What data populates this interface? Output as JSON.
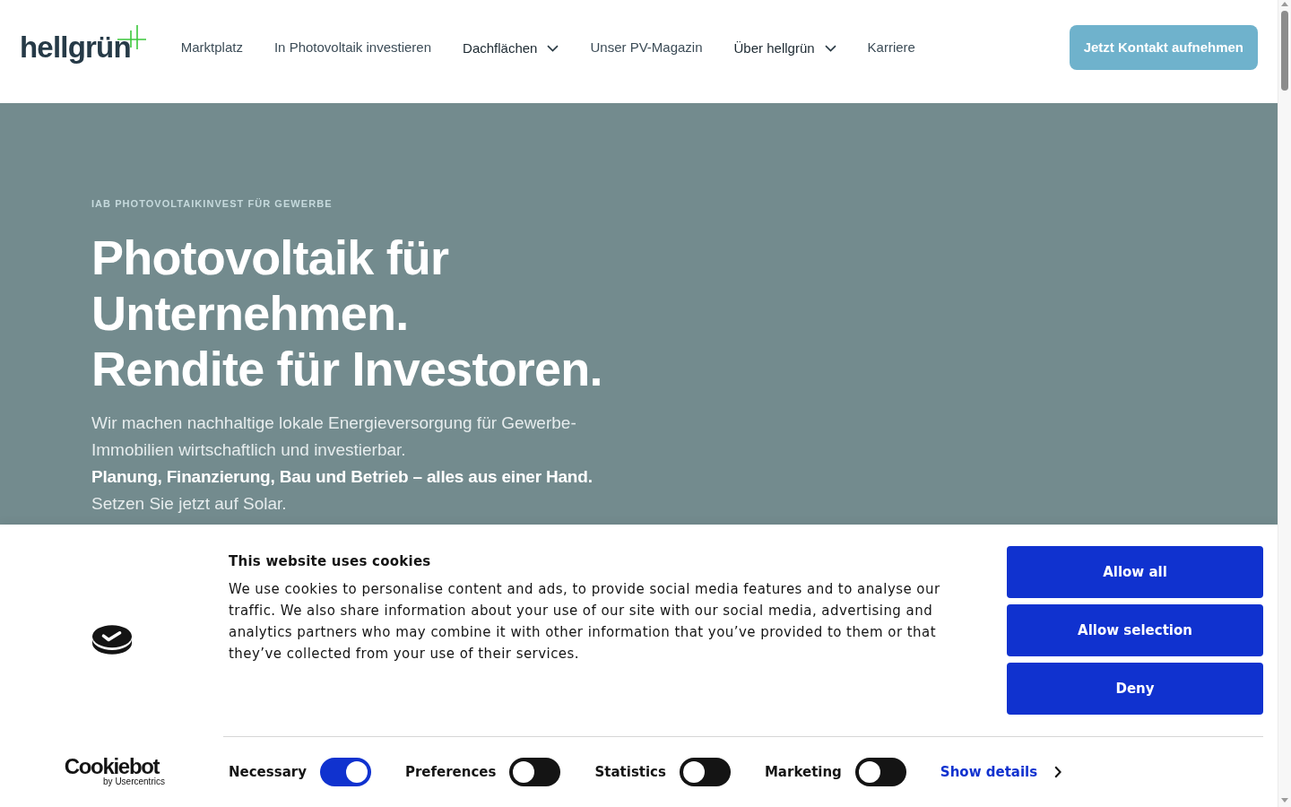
{
  "header": {
    "logo": "hellgrün",
    "nav": [
      {
        "label": "Marktplatz",
        "dropdown": false
      },
      {
        "label": "In Photovoltaik investieren",
        "dropdown": false
      },
      {
        "label": "Dachflächen",
        "dropdown": true
      },
      {
        "label": "Unser PV-Magazin",
        "dropdown": false
      },
      {
        "label": "Über hellgrün",
        "dropdown": true
      },
      {
        "label": "Karriere",
        "dropdown": false
      }
    ],
    "cta": "Jetzt Kontakt aufnehmen"
  },
  "hero": {
    "eyebrow": "IAB PHOTOVOLTAIKINVEST FÜR GEWERBE",
    "headline_lines": [
      "Photovoltaik für",
      "Unternehmen.",
      "Rendite für Investoren."
    ],
    "intro": "Wir machen nachhaltige lokale Energieversorgung für Gewerbe-Immobilien wirtschaftlich und investierbar.",
    "highlight": "Planung, Finanzierung, Bau und Betrieb – alles aus einer Hand.",
    "closing": "Setzen Sie jetzt auf Solar."
  },
  "cookie_banner": {
    "title": "This website uses cookies",
    "description": "We use cookies to personalise content and ads, to provide social media features and to analyse our traffic. We also share information about your use of our site with our social media, advertising and analytics partners who may combine it with other information that you’ve provided to them or that they’ve collected from your use of their services.",
    "buttons": [
      "Allow all",
      "Allow selection",
      "Deny"
    ],
    "categories": [
      {
        "label": "Necessary",
        "on": true
      },
      {
        "label": "Preferences",
        "on": false
      },
      {
        "label": "Statistics",
        "on": false
      },
      {
        "label": "Marketing",
        "on": false
      }
    ],
    "details_link": "Show details",
    "brand": {
      "name": "Cookiebot",
      "byline": "by Usercentrics"
    }
  }
}
